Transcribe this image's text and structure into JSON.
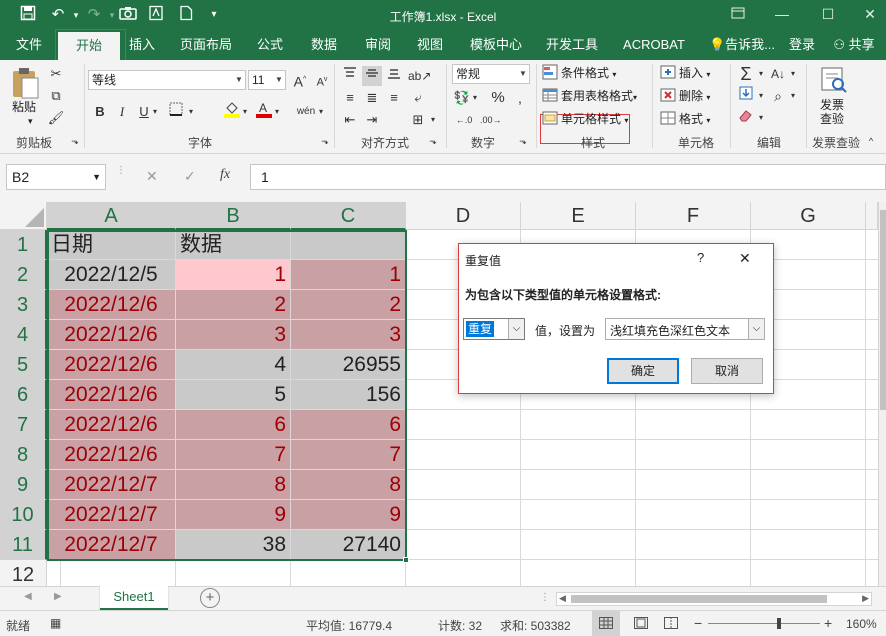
{
  "window": {
    "title": "工作簿1.xlsx - Excel"
  },
  "tabs": [
    {
      "label": "文件"
    },
    {
      "label": "开始"
    },
    {
      "label": "插入"
    },
    {
      "label": "页面布局"
    },
    {
      "label": "公式"
    },
    {
      "label": "数据"
    },
    {
      "label": "审阅"
    },
    {
      "label": "视图"
    },
    {
      "label": "模板中心"
    },
    {
      "label": "开发工具"
    },
    {
      "label": "ACROBAT"
    }
  ],
  "tell_me": "告诉我...",
  "login": "登录",
  "share": "共享",
  "ribbon": {
    "clipboard": {
      "paste": "粘贴",
      "label": "剪贴板"
    },
    "font": {
      "name": "等线",
      "size": "11",
      "label": "字体",
      "bold": "B",
      "italic": "I",
      "underline": "U"
    },
    "alignment": {
      "label": "对齐方式"
    },
    "number": {
      "format": "常规",
      "label": "数字"
    },
    "styles": {
      "conditional": "条件格式",
      "table": "套用表格格式",
      "cell": "单元格样式",
      "label": "样式"
    },
    "cells": {
      "insert": "插入",
      "delete": "删除",
      "format": "格式",
      "label": "单元格"
    },
    "editing": {
      "label": "编辑"
    },
    "review": {
      "check": "发票\n查验",
      "check1": "发票",
      "check2": "查验",
      "label": "发票查验"
    }
  },
  "formula_bar": {
    "name_box": "B2",
    "fx": "fx",
    "value": "1"
  },
  "columns": [
    "A",
    "B",
    "C",
    "D",
    "E",
    "F",
    "G"
  ],
  "rows": [
    "1",
    "2",
    "3",
    "4",
    "5",
    "6",
    "7",
    "8",
    "9",
    "10",
    "11",
    "12"
  ],
  "cells": {
    "A1": "日期",
    "B1": "数据",
    "C1": "",
    "A": [
      "2022/12/5",
      "2022/12/6",
      "2022/12/6",
      "2022/12/6",
      "2022/12/6",
      "2022/12/6",
      "2022/12/6",
      "2022/12/7",
      "2022/12/7",
      "2022/12/7"
    ],
    "B": [
      "1",
      "2",
      "3",
      "4",
      "5",
      "6",
      "7",
      "8",
      "9",
      "38"
    ],
    "C": [
      "1",
      "2",
      "3",
      "26955",
      "156",
      "6",
      "7",
      "8",
      "9",
      "27140"
    ]
  },
  "dialog": {
    "title": "重复值",
    "help": "?",
    "close": "✕",
    "prompt": "为包含以下类型值的单元格设置格式:",
    "type_value": "重复",
    "mid_label": "值，设置为",
    "format_value": "浅红填充色深红色文本",
    "ok": "确定",
    "cancel": "取消"
  },
  "sheet_tab": "Sheet1",
  "status": {
    "mode": "就绪",
    "average": "平均值: 16779.4",
    "count": "计数: 32",
    "sum": "求和: 503382",
    "zoom": "160%"
  },
  "colors": {
    "accent": "#217346",
    "dup_fill": "#c9a0a4",
    "dup_text": "#9c0006",
    "pink": "#ffc7ce",
    "gray": "#c9c9c9"
  }
}
